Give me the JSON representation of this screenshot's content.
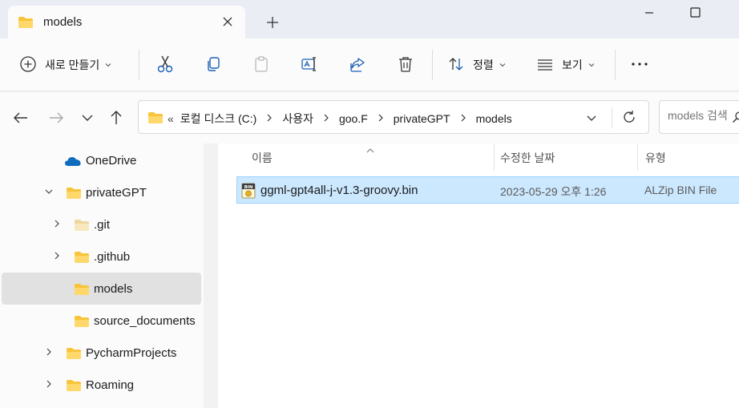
{
  "window": {
    "tab_title": "models"
  },
  "toolbar": {
    "new_label": "새로 만들기",
    "sort_label": "정렬",
    "view_label": "보기"
  },
  "address": {
    "overflow": "«",
    "crumbs": [
      "로컬 디스크 (C:)",
      "사용자",
      "goo.F",
      "privateGPT",
      "models"
    ]
  },
  "search": {
    "placeholder": "models 검색"
  },
  "sidebar": {
    "items": [
      {
        "label": "OneDrive"
      },
      {
        "label": "privateGPT"
      },
      {
        "label": ".git"
      },
      {
        "label": ".github"
      },
      {
        "label": "models"
      },
      {
        "label": "source_documents"
      },
      {
        "label": "PycharmProjects"
      },
      {
        "label": "Roaming"
      }
    ]
  },
  "columns": {
    "name": "이름",
    "date": "수정한 날짜",
    "type": "유형"
  },
  "files": [
    {
      "name": "ggml-gpt4all-j-v1.3-groovy.bin",
      "date": "2023-05-29 오후 1:26",
      "type": "ALZip BIN File",
      "badge": "BIN"
    }
  ],
  "colors": {
    "folder": "#f8c43a",
    "selection": "#cce8ff",
    "onedrive": "#0f6cbd"
  }
}
